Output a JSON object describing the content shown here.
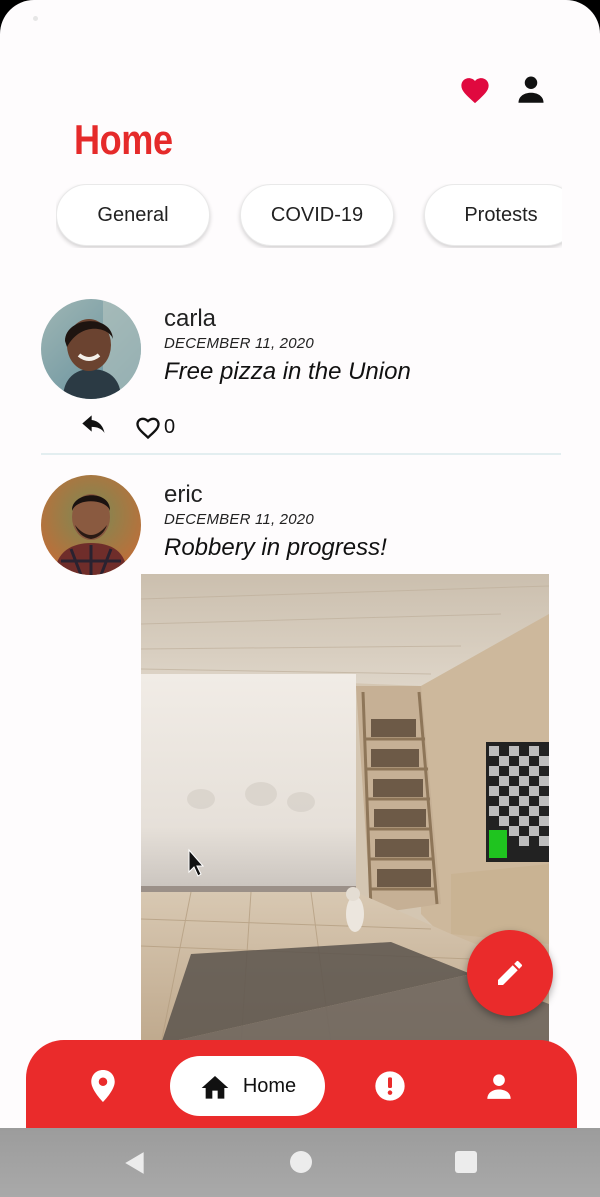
{
  "header": {
    "title": "Home"
  },
  "topbar": {
    "icons": [
      "heart-icon",
      "account-icon"
    ],
    "heart_color": "#e0093f"
  },
  "categories": [
    {
      "label": "General"
    },
    {
      "label": "COVID-19"
    },
    {
      "label": "Protests"
    }
  ],
  "posts": [
    {
      "username": "carla",
      "date": "DECEMBER 11, 2020",
      "text": "Free pizza in the Union",
      "likes": "0"
    },
    {
      "username": "eric",
      "date": "DECEMBER 11, 2020",
      "text": "Robbery in progress!"
    }
  ],
  "bottom_nav": {
    "items": [
      {
        "icon": "location-pin-icon"
      },
      {
        "icon": "home-icon",
        "label": "Home",
        "active": true
      },
      {
        "icon": "alert-icon"
      },
      {
        "icon": "account-icon"
      }
    ]
  },
  "fab": {
    "icon": "pencil-icon"
  },
  "colors": {
    "accent": "#ea2b2b",
    "title": "#e52a2a",
    "background": "#fefcfd"
  },
  "system_nav": [
    "back-icon",
    "home-circle-icon",
    "recents-icon"
  ]
}
